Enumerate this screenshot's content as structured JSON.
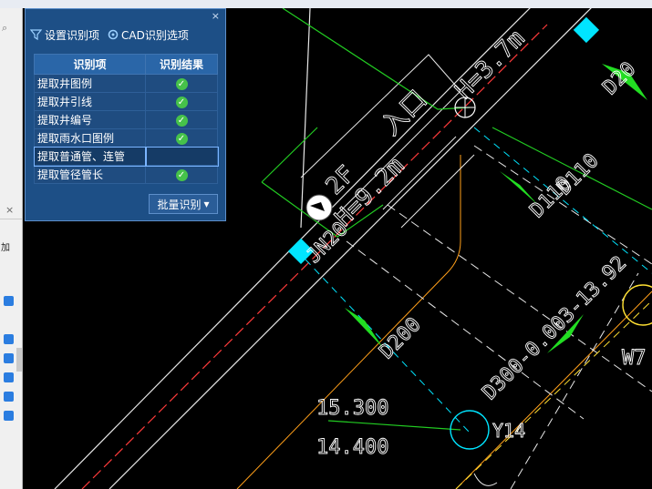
{
  "panel": {
    "close_label": "×",
    "toolbar": {
      "settings_label": "设置识别项",
      "cad_options_label": "CAD识别选项"
    },
    "columns": [
      "识别项",
      "识别结果"
    ],
    "rows": [
      {
        "name": "提取井图例",
        "done": true
      },
      {
        "name": "提取井引线",
        "done": true
      },
      {
        "name": "提取井编号",
        "done": true
      },
      {
        "name": "提取雨水口图例",
        "done": true
      },
      {
        "name": "提取普通管、连管",
        "done": false
      },
      {
        "name": "提取管径管长",
        "done": true
      }
    ],
    "check_glyph": "✓",
    "batch_label": "批量识别",
    "batch_arrow": "▾"
  },
  "host": {
    "x_label": "×",
    "field_char": "加"
  },
  "cad": {
    "text_ruyu": "入口",
    "text_h37": "H=3.7m",
    "text_2f": "2F",
    "text_h92": "H=9.2m",
    "text_jn20": "JN20",
    "text_d110a": "D110",
    "text_d110b": "D110",
    "text_d200": "D200",
    "text_d300": "D300-0.003-13.92",
    "text_d20": "D20",
    "text_w7": "W7",
    "text_y14": "Y14",
    "text_elev1": "15.300",
    "text_elev2": "14.400"
  },
  "colors": {
    "panel_bg": "#1d4f86",
    "accent": "#2a66a8",
    "green_line": "#22cc22",
    "cyan": "#00e5ff"
  }
}
